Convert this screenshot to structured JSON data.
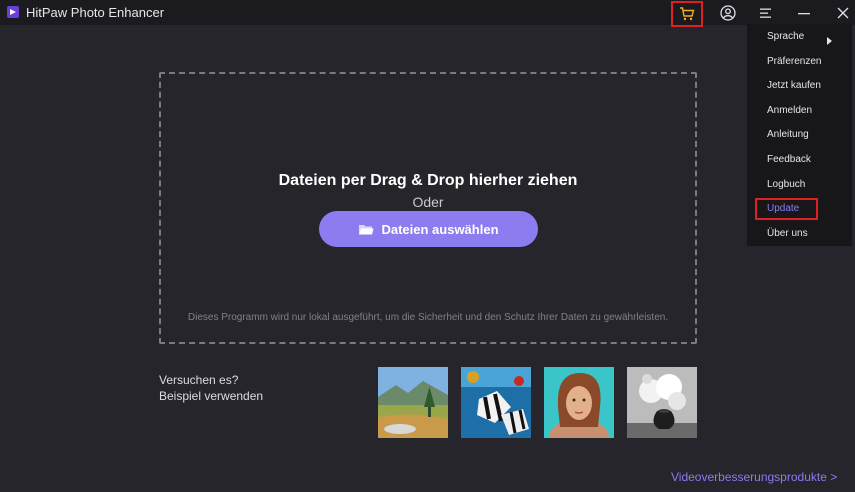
{
  "window": {
    "title": "HitPaw Photo Enhancer"
  },
  "icons": {
    "logo": "hitpaw-logo-icon",
    "cart": "shopping-cart-icon",
    "user": "user-account-icon",
    "menu": "hamburger-menu-icon",
    "minimize": "minimize-icon",
    "close": "close-icon",
    "folder": "folder-open-icon"
  },
  "dropzone": {
    "title": "Dateien per Drag & Drop hierher ziehen",
    "or": "Oder",
    "select_button": "Dateien auswählen",
    "note": "Dieses Programm wird nur lokal ausgeführt, um die Sicherheit und den Schutz Ihrer Daten zu gewährleisten."
  },
  "samples": {
    "line1": "Versuchen es?",
    "line2": "Beispiel verwenden"
  },
  "footer": {
    "video_link": "Videoverbesserungsprodukte >"
  },
  "menu": {
    "items": [
      "Sprache",
      "Präferenzen",
      "Jetzt kaufen",
      "Anmelden",
      "Anleitung",
      "Feedback",
      "Logbuch",
      "Update",
      "Über uns"
    ]
  },
  "colors": {
    "accent": "#8b7cf0",
    "highlight_box": "#e02020",
    "cart_icon": "#f0b020",
    "background": "#26252b"
  }
}
